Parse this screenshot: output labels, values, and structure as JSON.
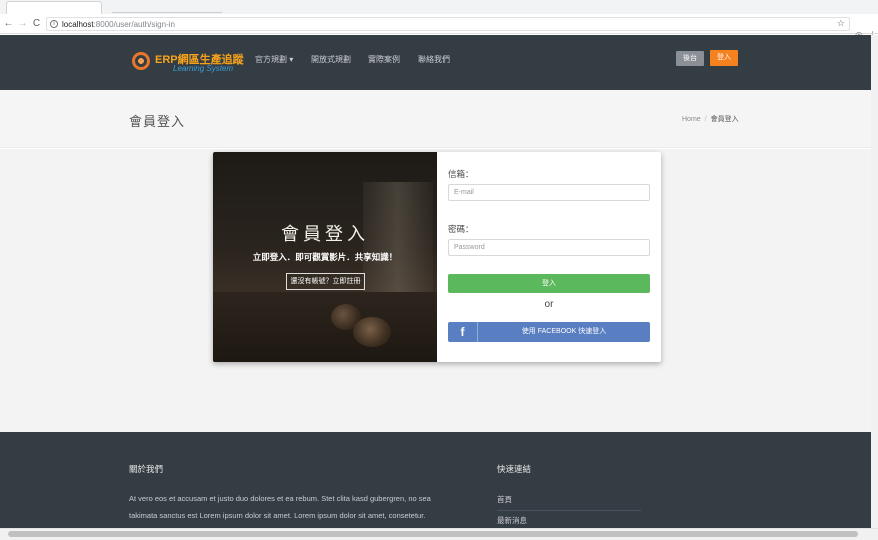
{
  "browser": {
    "url_host": "localhost",
    "url_path": ":8000/user/auth/sign-in",
    "info_icon": "info-icon",
    "bookmark_icon": "star-icon"
  },
  "header": {
    "logo_title": "ERP網區生產追蹤",
    "logo_subtitle": "Learning System",
    "menu": [
      "官方規劃 ▾",
      "開放式規劃",
      "實際案例",
      "聯絡我們"
    ],
    "admin_label": "後台",
    "login_label": "登入",
    "colors": {
      "bg": "#353d44",
      "accent": "#f5821f",
      "logo": "#f7a21b",
      "subtitle": "#3a9fdc"
    }
  },
  "page": {
    "title": "會員登入",
    "breadcrumb": [
      "Home",
      "會員登入"
    ]
  },
  "hero": {
    "title": "會員登入",
    "subtitle": "立即登入．即可觀賞影片．共享知識！",
    "button": "還沒有帳號？立即註冊"
  },
  "form": {
    "email_label": "信箱：",
    "email_placeholder": "E-mail",
    "password_label": "密碼：",
    "password_placeholder": "Password",
    "submit_label": "登入",
    "or_text": "or",
    "facebook_label": "使用 FACEBOOK 快速登入",
    "colors": {
      "submit": "#5cb85c",
      "facebook": "#5a7ec2"
    }
  },
  "footer": {
    "about_heading": "關於我們",
    "about_lines": [
      "At vero eos et accusam et justo duo dolores et ea rebum. Stet clita kasd gubergren, no sea",
      "takimata sanctus est Lorem ipsum dolor sit amet. Lorem ipsum dolor sit amet, consetetur."
    ],
    "links_heading": "快速連結",
    "links": [
      "首頁",
      "最新消息"
    ]
  }
}
